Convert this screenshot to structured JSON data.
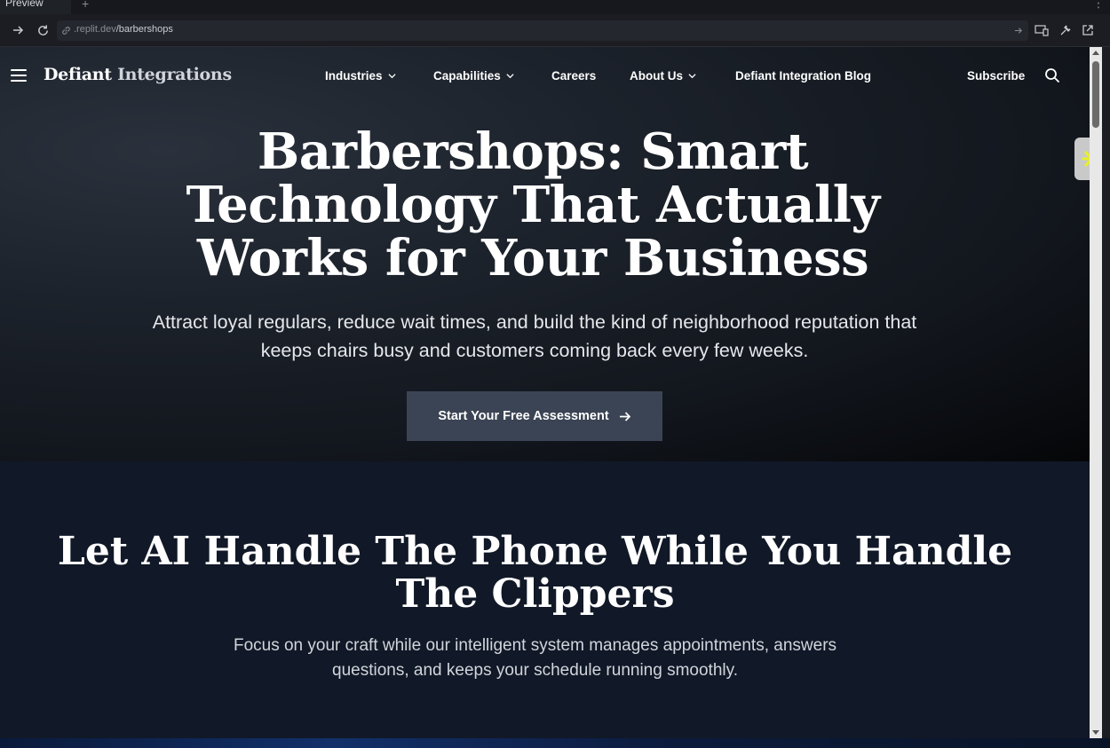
{
  "browser": {
    "tab_label": "Preview",
    "tab_add": "+",
    "menu_glyph": "⋮",
    "url_prefix": ".replit.dev",
    "url_path": "/barbershops"
  },
  "nav": {
    "brand_primary": "Defiant",
    "brand_secondary": "Integrations",
    "items": [
      {
        "label": "Industries",
        "dropdown": true
      },
      {
        "label": "Capabilities",
        "dropdown": true
      },
      {
        "label": "Careers",
        "dropdown": false
      },
      {
        "label": "About Us",
        "dropdown": true
      },
      {
        "label": "Defiant Integration Blog",
        "dropdown": false
      }
    ],
    "subscribe": "Subscribe"
  },
  "hero": {
    "title": "Barbershops: Smart Technology That Actually Works for Your Business",
    "subtitle": "Attract loyal regulars, reduce wait times, and build the kind of neighborhood reputation that keeps chairs busy and customers coming back every few weeks.",
    "cta": "Start Your Free Assessment"
  },
  "section2": {
    "title": "Let AI Handle The Phone While You Handle The Clippers",
    "subtitle": "Focus on your craft while our intelligent system manages appointments, answers questions, and keeps your schedule running smoothly."
  },
  "colors": {
    "cta_bg": "#3b4454",
    "section_bg": "#111827",
    "widget_accent": "#e6f02a"
  }
}
